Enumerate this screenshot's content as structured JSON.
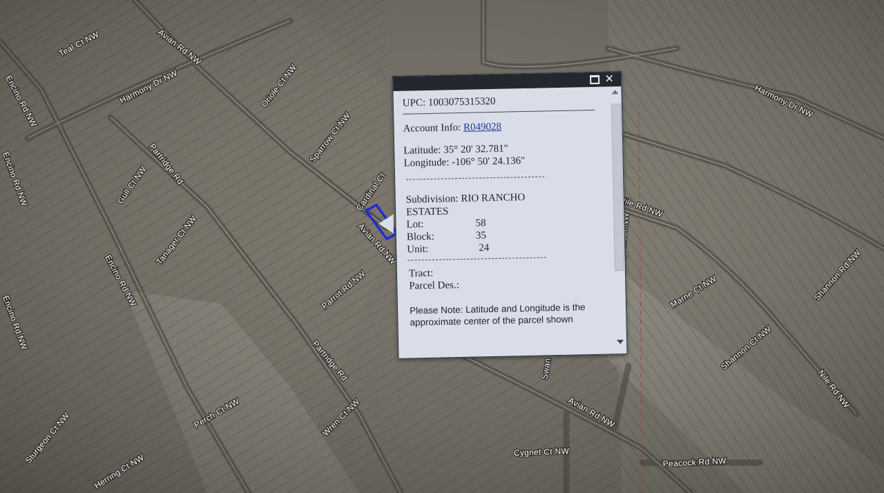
{
  "map": {
    "highlight_color": "#1a24e0",
    "road_labels": [
      "Teal Ct NW",
      "Avian Rd NW",
      "Harmony Dr NW",
      "Oriole Ct NW",
      "Sparrow Ct NW",
      "Encino Rd NW",
      "Partridge Rd",
      "Gull Ct NW",
      "Tanager Ct NW",
      "Cardinal Ct",
      "Avian Rd NW",
      "Parrot Rd NW",
      "Encino Rd NW",
      "Partridge Rd",
      "Wren Ct NW",
      "Perch Ct NW",
      "Sturgeon Ct NW",
      "Herring Ct NW",
      "Harmony Dr NW",
      "Nile Rd NW",
      "Lagoon Ct NW",
      "Marne Ct NW",
      "Shannon Rd NW",
      "Shannon Ct NW",
      "Nile Rd NW",
      "Avian Rd NW",
      "Swan",
      "Cygnet Ct NW",
      "Peacock Rd NW",
      "Encino Rd NW",
      "Encino Rd NW"
    ]
  },
  "popup": {
    "upc_label": "UPC:",
    "upc_value": "1003075315320",
    "account_label": "Account Info:",
    "account_value": "R049028",
    "latitude_label": "Latitude:",
    "latitude_value": "35° 20' 32.781\"",
    "longitude_label": "Longitude:",
    "longitude_value": "-106° 50' 24.136\"",
    "subdivision_label": "Subdivision:",
    "subdivision_value": "RIO RANCHO",
    "subdivision_value_2": "ESTATES",
    "lot_label": "Lot:",
    "lot_value": "58",
    "block_label": "Block:",
    "block_value": "35",
    "unit_label": "Unit:",
    "unit_value": "24",
    "tract_label": "Tract:",
    "parcel_label": "Parcel Des.:",
    "note": "Please Note: Latitude and Longitude is the approximate center of the parcel shown"
  }
}
